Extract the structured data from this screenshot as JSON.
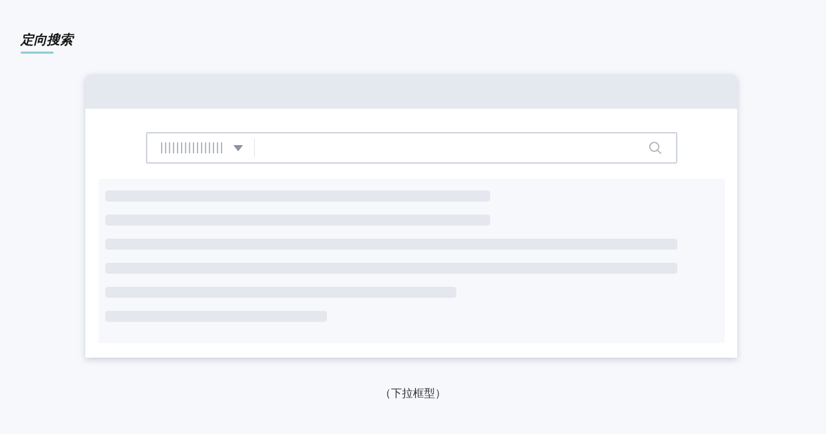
{
  "heading": {
    "title": "定向搜索"
  },
  "caption": "（下拉框型）"
}
